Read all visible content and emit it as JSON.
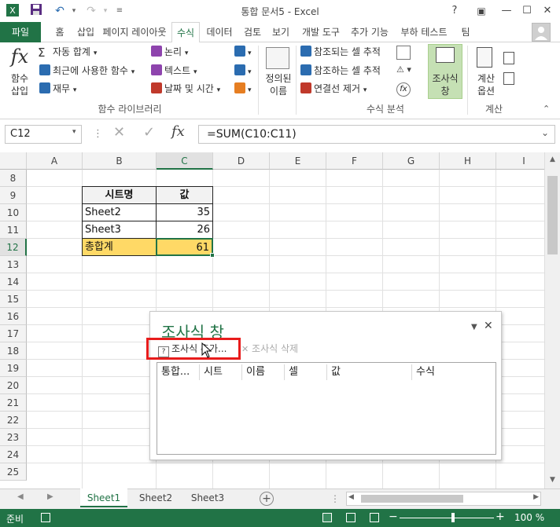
{
  "window": {
    "title": "통합 문서5 - Excel",
    "help": "?",
    "min": "—",
    "max": "☐",
    "close": "✕"
  },
  "tabs": [
    {
      "label": "파일"
    },
    {
      "label": "홈"
    },
    {
      "label": "삽입"
    },
    {
      "label": "페이지 레이아웃"
    },
    {
      "label": "수식"
    },
    {
      "label": "데이터"
    },
    {
      "label": "검토"
    },
    {
      "label": "보기"
    },
    {
      "label": "개발 도구"
    },
    {
      "label": "추가 기능"
    },
    {
      "label": "부하 테스트"
    },
    {
      "label": "팀"
    }
  ],
  "ribbon": {
    "insert_function": "함수\n삽입",
    "autosum": "자동 합계",
    "recent": "최근에 사용한 함수",
    "financial": "재무",
    "logical": "논리",
    "text": "텍스트",
    "datetime": "날짜 및 시간",
    "group_library": "함수 라이브러리",
    "defined_names": "정의된\n이름",
    "trace_precedents": "참조되는 셀 추적",
    "trace_dependents": "참조하는 셀 추적",
    "remove_arrows": "연결선 제거",
    "group_audit": "수식 분석",
    "watch_window": "조사식\n창",
    "calc_options": "계산\n옵션",
    "group_calc": "계산"
  },
  "formula_bar": {
    "name_box": "C12",
    "formula": "=SUM(C10:C11)",
    "fx": "fx"
  },
  "grid": {
    "columns": [
      "A",
      "B",
      "C",
      "D",
      "E",
      "F",
      "G",
      "H",
      "I"
    ],
    "rows": [
      "8",
      "9",
      "10",
      "11",
      "12",
      "13",
      "14",
      "15",
      "16",
      "17",
      "18",
      "19",
      "20",
      "21",
      "22",
      "23",
      "24",
      "25"
    ],
    "cells": {
      "B9": "시트명",
      "C9": "값",
      "B10": "Sheet2",
      "C10": "35",
      "B11": "Sheet3",
      "C11": "26",
      "B12": "총합계",
      "C12": "61"
    },
    "highlight_color": "#ffd966",
    "selected_cell": "C12"
  },
  "watch": {
    "title": "조사식 창",
    "add": "조사식 추가...",
    "delete": "조사식 삭제",
    "columns": [
      "통합...",
      "시트",
      "이름",
      "셀",
      "값",
      "수식"
    ]
  },
  "sheets": [
    "Sheet1",
    "Sheet2",
    "Sheet3"
  ],
  "status": {
    "ready": "준비",
    "zoom": "100 %"
  },
  "colors": {
    "accent": "#217346"
  }
}
